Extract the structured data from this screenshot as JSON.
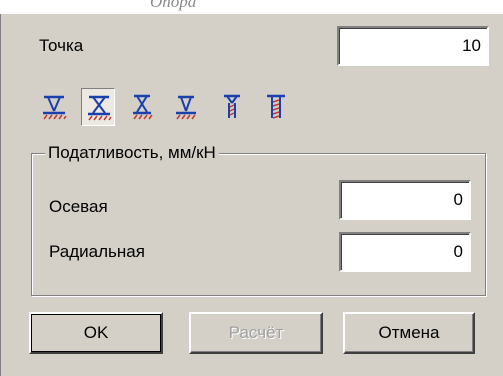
{
  "window": {
    "title": "Опора"
  },
  "point": {
    "label": "Точка",
    "value": "10"
  },
  "support_types": [
    {
      "icon": "support-type-1-icon"
    },
    {
      "icon": "support-type-2-icon",
      "selected": true
    },
    {
      "icon": "support-type-3-icon"
    },
    {
      "icon": "support-type-4-icon"
    },
    {
      "icon": "support-type-5-icon"
    },
    {
      "icon": "support-type-6-icon"
    }
  ],
  "compliance": {
    "title": "Податливость, мм/кН",
    "axial": {
      "label": "Осевая",
      "value": "0"
    },
    "radial": {
      "label": "Радиальная",
      "value": "0"
    }
  },
  "buttons": {
    "ok": "OK",
    "calc": "Расчёт",
    "cancel": "Отмена"
  },
  "colors": {
    "dialog_bg": "#d4d0c8",
    "icon_blue": "#1a3fae",
    "icon_red": "#c0392b"
  }
}
